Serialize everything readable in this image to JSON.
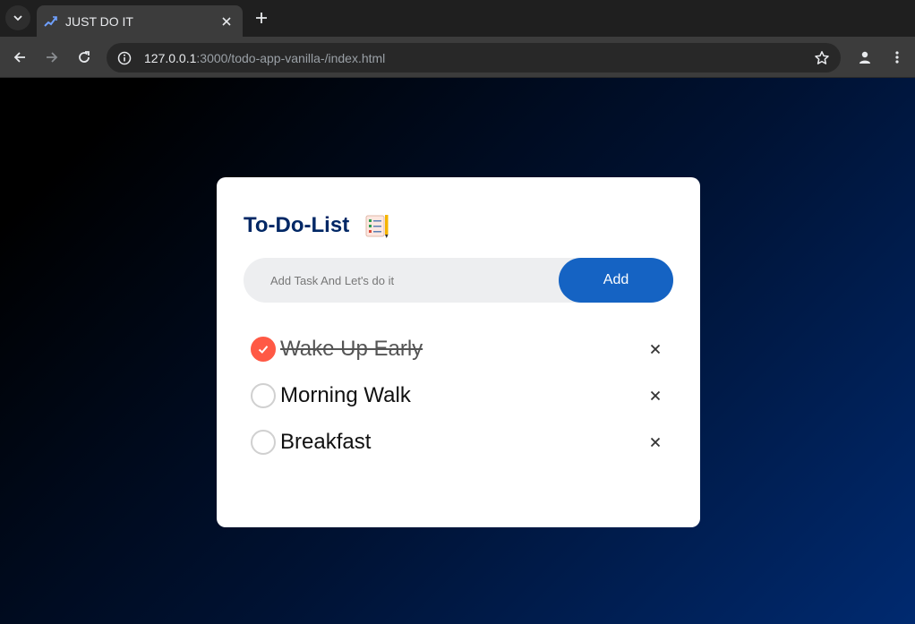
{
  "browser": {
    "tab_title": "JUST DO IT",
    "url_host": "127.0.0.1",
    "url_rest": ":3000/todo-app-vanilla-/index.html"
  },
  "app": {
    "title": "To-Do-List",
    "input_placeholder": "Add Task And Let's do it",
    "input_value": "",
    "add_label": "Add",
    "colors": {
      "accent": "#1563c3",
      "heading": "#002765",
      "checked": "#ff5945"
    },
    "tasks": [
      {
        "text": "Wake Up Early",
        "done": true
      },
      {
        "text": "Morning Walk",
        "done": false
      },
      {
        "text": "Breakfast",
        "done": false
      }
    ]
  }
}
